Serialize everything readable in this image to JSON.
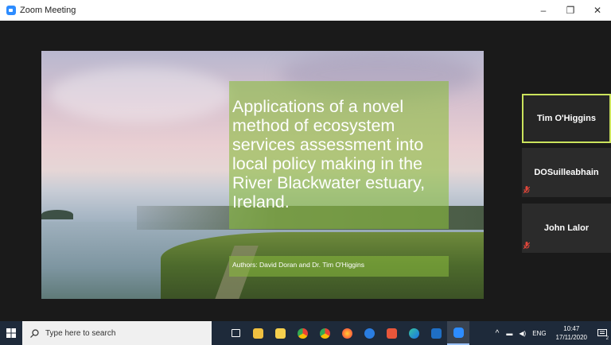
{
  "window": {
    "title": "Zoom Meeting",
    "controls": {
      "minimize": "–",
      "maximize": "❐",
      "close": "✕"
    }
  },
  "slide": {
    "title": "Applications of a novel method of ecosystem services assessment into local policy making in the River Blackwater estuary, Ireland.",
    "authors": "Authors: David Doran and Dr. Tim O'Higgins",
    "accent_color": "#8bbc3e"
  },
  "participants": [
    {
      "name": "Tim O'Higgins",
      "active": true,
      "muted": false
    },
    {
      "name": "DOSuilleabhain",
      "active": false,
      "muted": true
    },
    {
      "name": "John Lalor",
      "active": false,
      "muted": true
    }
  ],
  "taskbar": {
    "search_placeholder": "Type here to search",
    "apps": [
      "task-view-icon",
      "file-explorer-icon",
      "sticky-notes-icon",
      "chrome-icon",
      "chrome-alt-icon",
      "firefox-icon",
      "edge-icon",
      "office-icon",
      "edge-new-icon",
      "outlook-icon",
      "zoom-icon"
    ],
    "tray": {
      "language": "ENG",
      "time": "10:47",
      "date": "17/11/2020",
      "notifications": "2"
    }
  }
}
